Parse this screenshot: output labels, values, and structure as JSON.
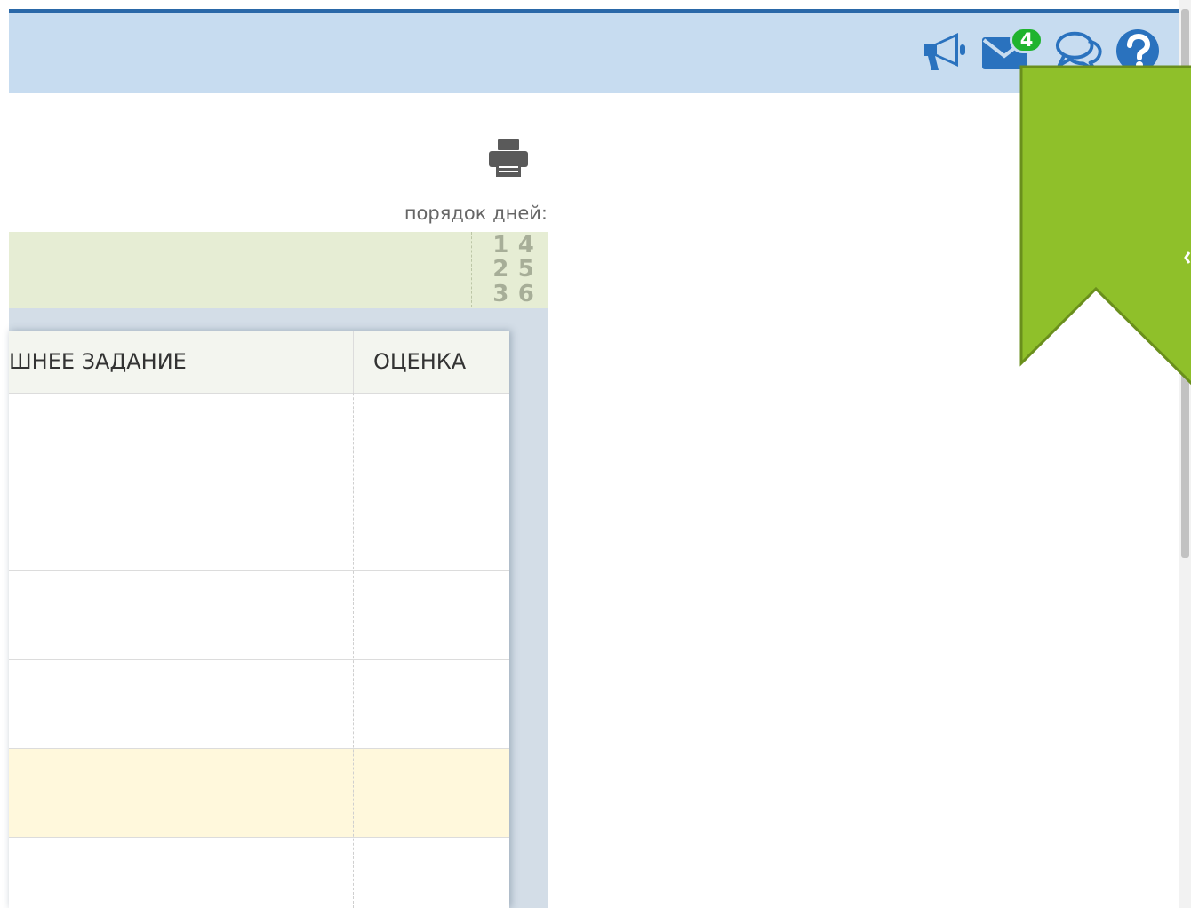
{
  "header": {
    "icons": [
      "megaphone-icon",
      "mail-icon",
      "chat-icon",
      "help-icon"
    ],
    "mail_unread_count": "4",
    "colors": {
      "bar": "#c7dcf0",
      "topline": "#2a68a8",
      "icon": "#2a72be",
      "badge": "#1fb32e"
    }
  },
  "toolbar": {
    "print_icon": "printer-icon"
  },
  "days_order": {
    "label": "порядок дней:",
    "cells": [
      "1",
      "4",
      "2",
      "5",
      "3",
      "6"
    ]
  },
  "table": {
    "columns": [
      {
        "key": "homework",
        "label": "ШНЕЕ ЗАДАНИЕ"
      },
      {
        "key": "grade",
        "label": "ОЦЕНКА"
      }
    ],
    "rows": [
      {
        "homework": "",
        "grade": "",
        "highlight": false
      },
      {
        "homework": "",
        "grade": "",
        "highlight": false
      },
      {
        "homework": "",
        "grade": "",
        "highlight": false
      },
      {
        "homework": "",
        "grade": "",
        "highlight": false
      },
      {
        "homework": "",
        "grade": "",
        "highlight": true
      },
      {
        "homework": "",
        "grade": "",
        "highlight": false
      }
    ]
  },
  "bookmark": {
    "color": "#8fc02a",
    "icon": "bookmark-ribbon-icon"
  }
}
